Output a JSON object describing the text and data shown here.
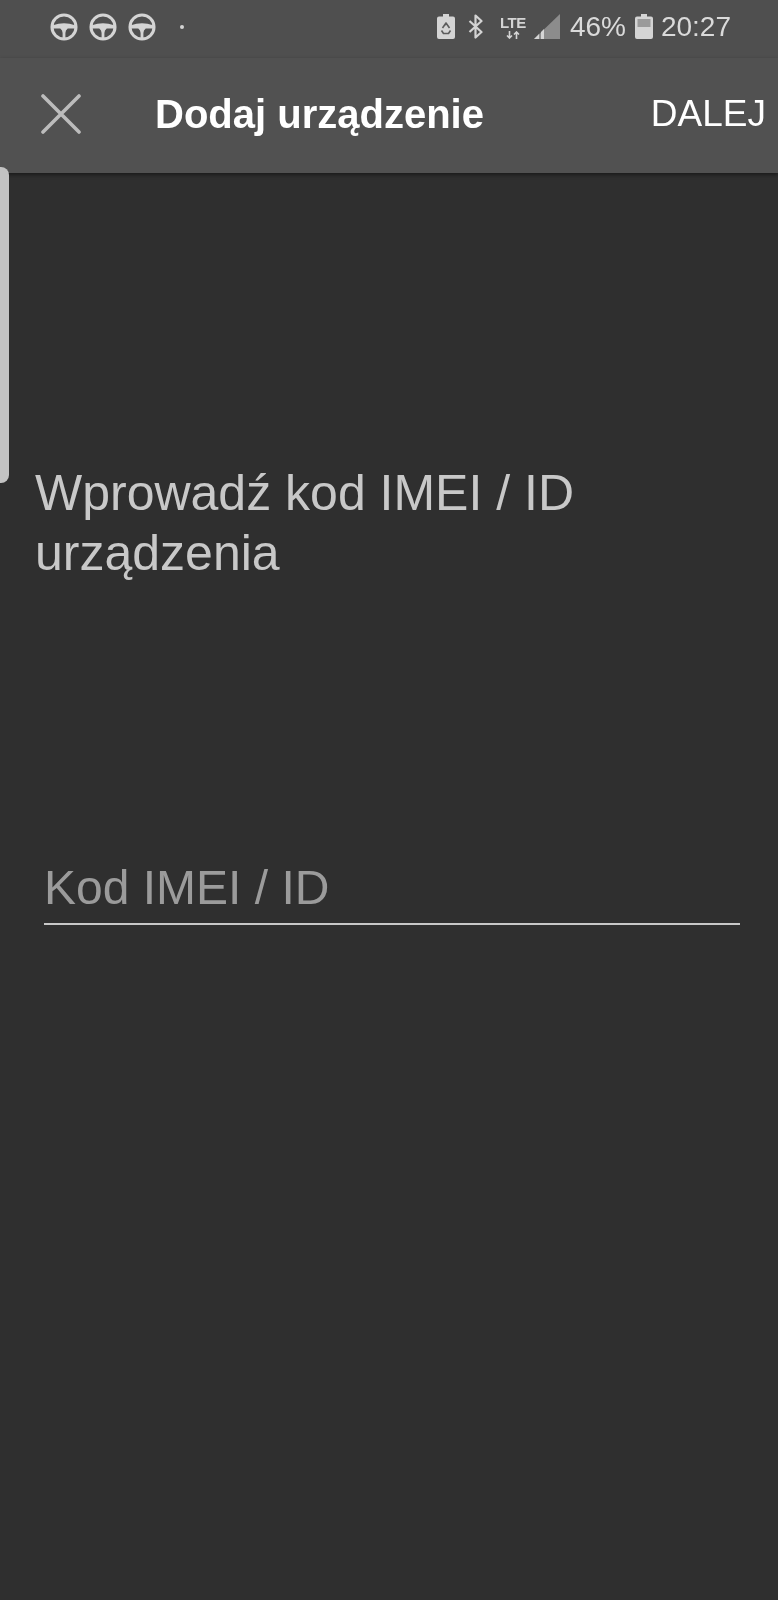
{
  "status_bar": {
    "network_type": "LTE",
    "battery_percent": "46%",
    "time": "20:27"
  },
  "app_bar": {
    "title": "Dodaj urządzenie",
    "action": "DALEJ"
  },
  "prompt": "Wprowadź kod IMEI / ID urządzenia",
  "imei_field": {
    "placeholder": "Kod IMEI / ID"
  }
}
